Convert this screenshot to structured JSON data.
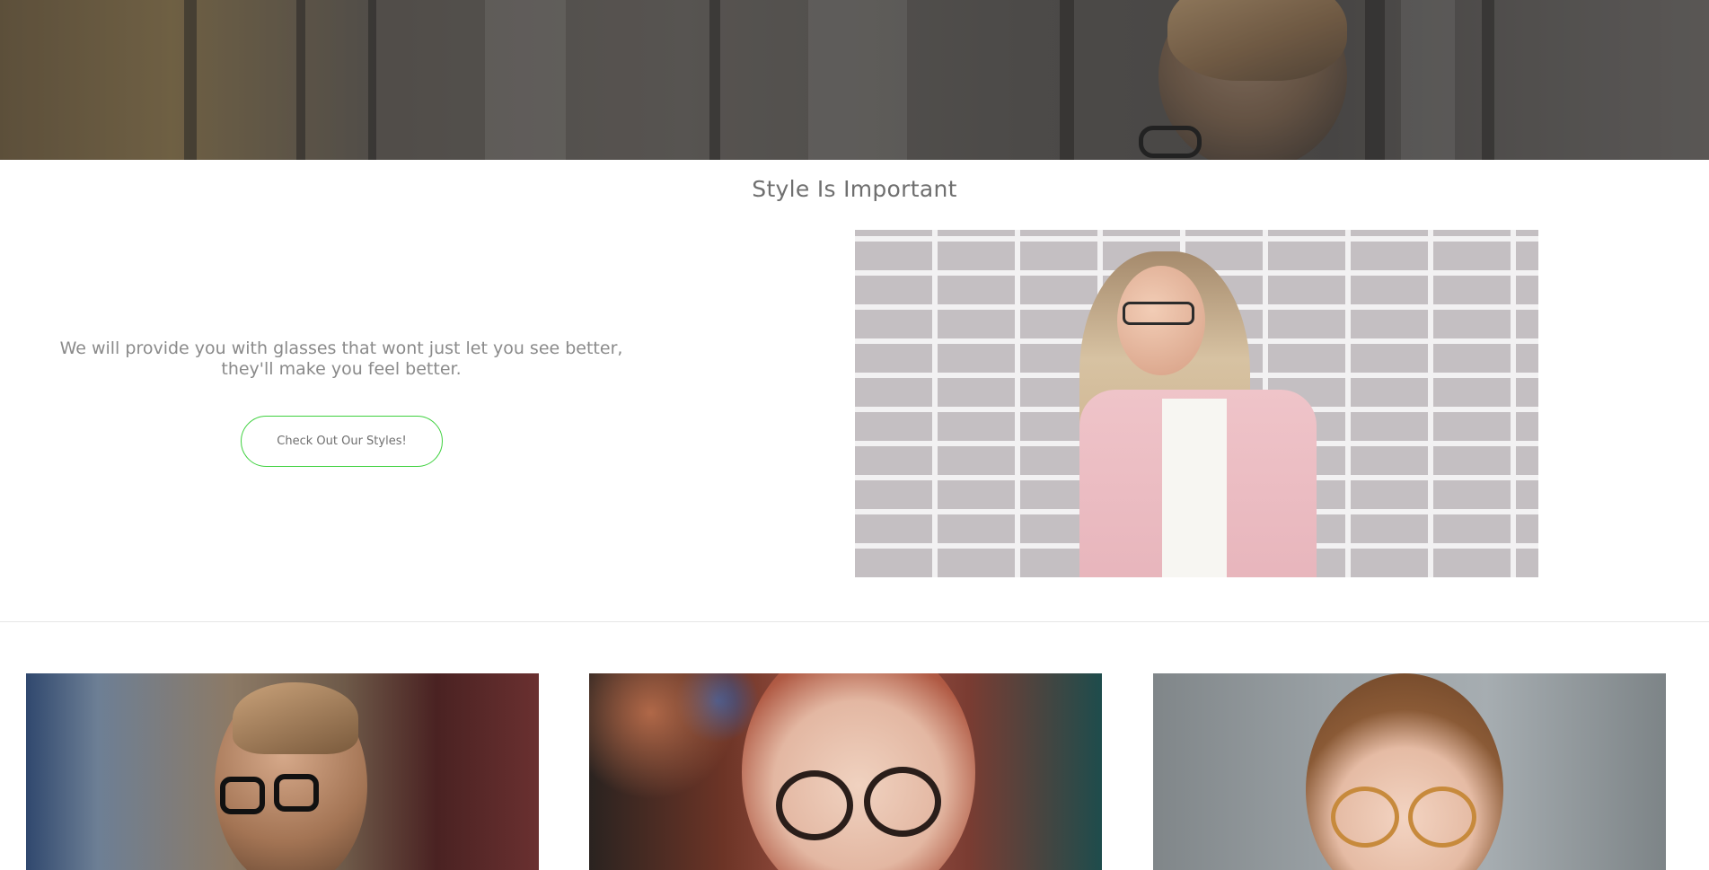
{
  "hero": {
    "image_alt": "Man wearing black glasses near a window"
  },
  "intro": {
    "title": "Style Is Important",
    "tagline": "We will provide you with glasses that wont just let you see better, they'll make you feel better.",
    "cta_label": "Check Out Our Styles!",
    "feature_image_alt": "Woman with glasses in a pink jacket against a white brick wall"
  },
  "gallery": {
    "cards": [
      {
        "image_alt": "Bearded man wearing black rectangular glasses"
      },
      {
        "image_alt": "Red-haired woman adjusting round tortoiseshell glasses"
      },
      {
        "image_alt": "Curly-haired child wearing round amber glasses"
      }
    ]
  },
  "colors": {
    "accent_border": "#3fd13f",
    "text": "#7a7a7a",
    "background": "#ffffff"
  }
}
